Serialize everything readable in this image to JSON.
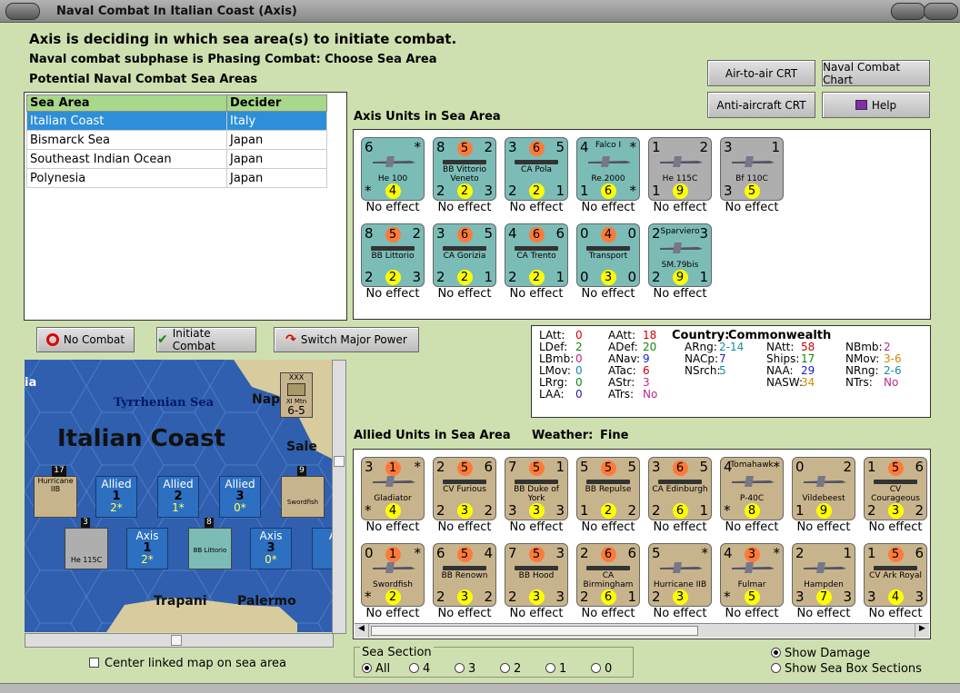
{
  "window": {
    "title": "Naval Combat In Italian Coast (Axis)"
  },
  "header": {
    "line1": "Axis is deciding in which sea area(s) to initiate combat.",
    "line2": "Naval combat subphase is Phasing Combat: Choose Sea Area",
    "line3": "Potential Naval Combat Sea Areas"
  },
  "buttons": {
    "air_crt": "Air-to-air CRT",
    "naval_chart": "Naval Combat Chart",
    "aa_crt": "Anti-aircraft CRT",
    "help": "Help",
    "no_combat": "No Combat",
    "initiate": "Initiate Combat",
    "switch": "Switch Major Power"
  },
  "sea_table": {
    "headers": [
      "Sea Area",
      "Decider"
    ],
    "rows": [
      [
        "Italian Coast",
        "Italy"
      ],
      [
        "Bismarck Sea",
        "Japan"
      ],
      [
        "Southeast Indian Ocean",
        "Japan"
      ],
      [
        "Polynesia",
        "Japan"
      ]
    ]
  },
  "axis_section": {
    "title": "Axis Units in Sea Area"
  },
  "axis_units": [
    {
      "name": "He 100",
      "tl": "6",
      "tr": "*",
      "bl": "*",
      "bc": "4",
      "kind": "plane",
      "color": "#7cbcb6",
      "effect": "No effect"
    },
    {
      "name": "BB Vittorio Veneto",
      "tl": "8",
      "tc": "5",
      "tr": "2",
      "bl": "2",
      "bc": "2",
      "br": "3",
      "kind": "ship",
      "color": "#7cbcb6",
      "effect": "No effect"
    },
    {
      "name": "CA Pola",
      "tl": "3",
      "tc": "6",
      "tr": "5",
      "bl": "2",
      "bc": "2",
      "br": "1",
      "kind": "ship",
      "color": "#7cbcb6",
      "effect": "No effect"
    },
    {
      "name": "Re.2000",
      "tl": "4",
      "tr": "*",
      "bl": "1",
      "bc": "6",
      "br": "*",
      "kind": "plane",
      "color": "#7cbcb6",
      "effect": "No effect",
      "sub": "Falco I"
    },
    {
      "name": "He 115C",
      "tl": "1",
      "tr": "2",
      "bl": "1",
      "bc": "9",
      "kind": "plane",
      "color": "#aeaeae",
      "effect": "No effect"
    },
    {
      "name": "Bf 110C",
      "tl": "3",
      "tr": "1",
      "bl": "3",
      "bc": "5",
      "kind": "plane",
      "color": "#aeaeae",
      "effect": "No effect"
    },
    {
      "name": "BB Littorio",
      "tl": "8",
      "tc": "5",
      "tr": "2",
      "bl": "2",
      "bc": "2",
      "br": "3",
      "kind": "ship",
      "color": "#7cbcb6",
      "effect": "No effect"
    },
    {
      "name": "CA Gorizia",
      "tl": "3",
      "tc": "6",
      "tr": "5",
      "bl": "2",
      "bc": "2",
      "br": "1",
      "kind": "ship",
      "color": "#7cbcb6",
      "effect": "No effect"
    },
    {
      "name": "CA Trento",
      "tl": "4",
      "tc": "6",
      "tr": "6",
      "bl": "2",
      "bc": "2",
      "br": "1",
      "kind": "ship",
      "color": "#7cbcb6",
      "effect": "No effect"
    },
    {
      "name": "Transport",
      "tl": "0",
      "tc": "4",
      "tr": "0",
      "bl": "0",
      "bc": "3",
      "br": "0",
      "kind": "ship",
      "color": "#7cbcb6",
      "effect": "No effect"
    },
    {
      "name": "SM.79bis",
      "tl": "2",
      "tr": "3",
      "bl": "2",
      "bc": "9",
      "br": "1",
      "kind": "plane",
      "color": "#7cbcb6",
      "effect": "No effect",
      "sub": "Sparviero"
    }
  ],
  "stats": {
    "country_label": "Country:",
    "country": "Commonwealth",
    "items": [
      [
        "LAtt:",
        "0",
        "red"
      ],
      [
        "LDef:",
        "2",
        "grn"
      ],
      [
        "LBmb:",
        "0",
        "prp"
      ],
      [
        "LMov:",
        "0",
        "tea"
      ],
      [
        "LRrg:",
        "0",
        "grn"
      ],
      [
        "LAA:",
        "0",
        "nav"
      ],
      [
        "AAtt:",
        "18",
        "red"
      ],
      [
        "ADef:",
        "20",
        "grn"
      ],
      [
        "ANav:",
        "9",
        "blu"
      ],
      [
        "ATac:",
        "6",
        "red"
      ],
      [
        "AStr:",
        "3",
        "prp"
      ],
      [
        "ATrs:",
        "No",
        "prp"
      ],
      [
        "ARng:",
        "2-14",
        "tea"
      ],
      [
        "NACp:",
        "7",
        "blu"
      ],
      [
        "NSrch:",
        "5",
        "tea"
      ],
      [
        "NAtt:",
        "58",
        "red"
      ],
      [
        "Ships:",
        "17",
        "grn"
      ],
      [
        "NAA:",
        "29",
        "blu"
      ],
      [
        "NASW:",
        "34",
        "org"
      ],
      [
        "NBmb:",
        "2",
        "prp"
      ],
      [
        "NMov:",
        "3-6",
        "org"
      ],
      [
        "NRng:",
        "2-6",
        "tea"
      ],
      [
        "NTrs:",
        "No",
        "prp"
      ]
    ]
  },
  "allied_section": {
    "title": "Allied Units in Sea Area",
    "weather_label": "Weather:",
    "weather": "Fine"
  },
  "allied_units": [
    {
      "name": "Gladiator",
      "tl": "3",
      "tc": "1",
      "tr": "*",
      "bl": "*",
      "bc": "4",
      "kind": "plane",
      "effect": "No effect"
    },
    {
      "name": "CV Furious",
      "tl": "2",
      "tc": "5",
      "tr": "6",
      "bl": "2",
      "bc": "3",
      "br": "2",
      "kind": "ship",
      "effect": "No effect"
    },
    {
      "name": "BB Duke of York",
      "tl": "7",
      "tc": "5",
      "tr": "1",
      "bl": "3",
      "bc": "3",
      "br": "3",
      "kind": "ship",
      "effect": "No effect"
    },
    {
      "name": "BB Repulse",
      "tl": "5",
      "tc": "5",
      "tr": "5",
      "bl": "1",
      "bc": "2",
      "br": "2",
      "kind": "ship",
      "effect": "No effect"
    },
    {
      "name": "CA Edinburgh",
      "tl": "3",
      "tc": "6",
      "tr": "5",
      "bl": "2",
      "bc": "6",
      "br": "1",
      "kind": "ship",
      "effect": "No effect"
    },
    {
      "name": "P-40C",
      "tl": "4",
      "tr": "*",
      "bl": "*",
      "bc": "8",
      "kind": "plane",
      "effect": "No effect",
      "sub": "Tomahawk"
    },
    {
      "name": "Vildebeest",
      "tl": "0",
      "tr": "2",
      "bl": "1",
      "bc": "9",
      "kind": "plane",
      "effect": "No effect"
    },
    {
      "name": "CV Courageous",
      "tl": "1",
      "tc": "5",
      "tr": "6",
      "bl": "2",
      "bc": "3",
      "br": "2",
      "kind": "ship",
      "effect": "No effect"
    },
    {
      "name": "Swordfish",
      "tl": "0",
      "tc": "1",
      "tr": "*",
      "bl": "*",
      "bc": "2",
      "kind": "plane",
      "effect": "No effect"
    },
    {
      "name": "BB Renown",
      "tl": "6",
      "tc": "5",
      "tr": "4",
      "bl": "2",
      "bc": "3",
      "br": "2",
      "kind": "ship",
      "effect": "No effect"
    },
    {
      "name": "BB Hood",
      "tl": "7",
      "tc": "5",
      "tr": "3",
      "bl": "2",
      "bc": "3",
      "br": "3",
      "kind": "ship",
      "effect": "No effect"
    },
    {
      "name": "CA Birmingham",
      "tl": "2",
      "tc": "6",
      "tr": "6",
      "bl": "2",
      "bc": "6",
      "br": "1",
      "kind": "ship",
      "effect": "No effect"
    },
    {
      "name": "Hurricane IIB",
      "tl": "5",
      "tr": "*",
      "bl": "2",
      "bc": "3",
      "kind": "plane",
      "effect": "No effect"
    },
    {
      "name": "Fulmar",
      "tl": "4",
      "tc": "3",
      "tr": "*",
      "bl": "*",
      "bc": "5",
      "kind": "plane",
      "effect": "No effect"
    },
    {
      "name": "Hampden",
      "tl": "2",
      "tr": "1",
      "bl": "3",
      "bc": "7",
      "br": "3",
      "kind": "plane",
      "effect": "No effect"
    },
    {
      "name": "CV Ark Royal",
      "tl": "1",
      "tc": "5",
      "tr": "6",
      "bl": "3",
      "bc": "4",
      "br": "3",
      "kind": "ship",
      "effect": "No effect"
    }
  ],
  "map": {
    "tyrrhenian": "Tyrrhenian Sea",
    "italian_coast": "Italian Coast",
    "napoli": "Napi",
    "salerno": "Sale",
    "trapani": "Trapani",
    "palermo": "Palermo",
    "ia": "ia",
    "corps_top": "XXX",
    "corps_name": "XI Mtn",
    "corps_val": "6-5",
    "boxes": [
      {
        "side": "Allied",
        "n": "1",
        "v": "2*"
      },
      {
        "side": "Allied",
        "n": "2",
        "v": "1*"
      },
      {
        "side": "Allied",
        "n": "3",
        "v": "0*"
      },
      {
        "side": "Axis",
        "n": "1",
        "v": "2*"
      },
      {
        "side": "Axis",
        "n": "3",
        "v": "0*"
      },
      {
        "side": "A",
        "n": "",
        "v": ""
      }
    ],
    "stack_counts": [
      "17",
      "3",
      "8",
      "9"
    ],
    "mini": {
      "hurricane": "Hurricane IIB",
      "he115": "He 115C",
      "littorio": "BB Littorio",
      "swordfish": "Swordfish",
      "mk": "Mk. I",
      "ha": "Ha"
    }
  },
  "center_option": "Center linked map on sea area",
  "sea_section": {
    "label": "Sea Section",
    "options": [
      "All",
      "4",
      "3",
      "2",
      "1",
      "0"
    ],
    "selected": "All"
  },
  "display": {
    "show_damage": "Show Damage",
    "show_boxes": "Show Sea Box Sections"
  }
}
